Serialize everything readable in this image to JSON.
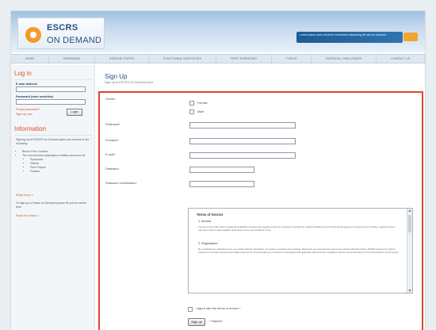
{
  "header": {
    "logo_line1": "ESCRS",
    "logo_line2": "ON DEMAND",
    "promo_text": "Lorem ipsum dolor sit amet consectetur adipiscing elit sed do eiusmod"
  },
  "nav": {
    "items": [
      "HOME",
      "ONDEMAND",
      "DISEASE STATES",
      "FUNCTIONAL SUBTLETIES",
      "FIRST SURGEONS",
      "TOPICS",
      "SURGICAL CHALLENGES",
      "CONTACT US"
    ]
  },
  "sidebar": {
    "login_heading": "Log in",
    "email_label": "E-mail address",
    "password_label": "Password (case sensitive)",
    "forgot_link": "Forgot password?",
    "signup_link": "Sign up now",
    "login_button": "Login",
    "info_heading": "Information",
    "info_text": "Signing up to ESCRS on Demand gives you access to the following:",
    "benefits": [
      "Bonus Free Content",
      "The new Annual subscription entitles access to all:"
    ],
    "sub_benefits": [
      "Symposia",
      "Videos",
      "Free Papers",
      "Posters"
    ],
    "more_link": "Read more »",
    "promo_text": "To sign up to Radio on Demand please fill out the online form",
    "read_more_link": "Read our terms »"
  },
  "main": {
    "title": "Sign Up",
    "subtitle": "Sign up to ESCRS On Demand here",
    "gender_label": "Gender",
    "gender_options": [
      "Female",
      "Male"
    ],
    "first_name_label": "Firstname*",
    "surname_label": "Surname*",
    "email_label": "E-mail*",
    "password_label": "Password",
    "password_confirm_label": "Password confirmation*",
    "terms_title": "Terms of Service",
    "terms_h1": "1. Access",
    "terms_p1": "The use of this online offer is designed for ESCRS members and registered users for purposes of continuing medical education and professional development. Access is free of charge; registered users may view content made available under these terms and conditions of use.",
    "terms_h2": "2. Registration",
    "terms_p2": "By completing the registration form you confirm that the information you supply is accurate and complete. Passwords are personal and must not be shared with third parties. ESCRS reserves the right to suspend or terminate accounts that violate these terms. Personal data are processed in accordance with applicable data protection regulations and are used exclusively for the administration of this service.",
    "agree_label": "I agree with the terms of service *",
    "signup_button": "Sign up",
    "required_note": "* required"
  }
}
